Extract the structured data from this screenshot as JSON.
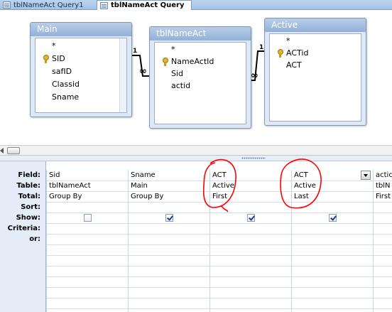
{
  "tabs": [
    {
      "label": "tblNameAct Query1",
      "active": false
    },
    {
      "label": "tblNameAct Query",
      "active": true
    }
  ],
  "tables": {
    "main": {
      "title": "Main",
      "fields": [
        "*",
        "SID",
        "safID",
        "Classid",
        "Sname"
      ],
      "key_field": "SID"
    },
    "nameact": {
      "title": "tblNameAct",
      "fields": [
        "*",
        "NameActId",
        "Sid",
        "actid"
      ],
      "key_field": "NameActId"
    },
    "active": {
      "title": "Active",
      "fields": [
        "*",
        "ACTid",
        "ACT"
      ],
      "key_field": "ACTid"
    }
  },
  "joins": [
    {
      "one_side": "1",
      "many_side": "∞"
    },
    {
      "one_side": "1",
      "many_side": "∞"
    }
  ],
  "grid": {
    "row_labels": {
      "field": "Field:",
      "table": "Table:",
      "total": "Total:",
      "sort": "Sort:",
      "show": "Show:",
      "criteria": "Criteria:",
      "or": "or:"
    },
    "columns": [
      {
        "field": "Sid",
        "table": "tblNameAct",
        "total": "Group By",
        "show": false
      },
      {
        "field": "Sname",
        "table": "Main",
        "total": "Group By",
        "show": true
      },
      {
        "field": "ACT",
        "table": "Active",
        "total": "First",
        "show": true
      },
      {
        "field": "ACT",
        "table": "Active",
        "total": "Last",
        "show": true
      },
      {
        "field": "actic",
        "table": "tblN",
        "total": "First",
        "show": null
      }
    ]
  },
  "colors": {
    "annotation": "#ff0000",
    "table_title": "#93b0d8",
    "row_header": "#e4ecf7"
  }
}
